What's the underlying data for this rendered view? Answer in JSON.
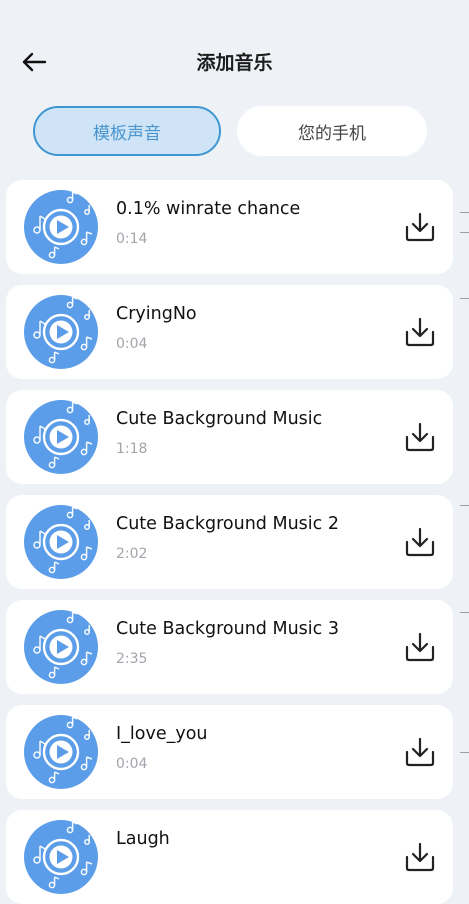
{
  "header": {
    "title": "添加音乐"
  },
  "tabs": [
    {
      "label": "模板声音",
      "active": true
    },
    {
      "label": "您的手机",
      "active": false
    }
  ],
  "songs": [
    {
      "title": "0.1% winrate chance",
      "duration": "0:14"
    },
    {
      "title": "CryingNo",
      "duration": "0:04"
    },
    {
      "title": "Cute Background Music",
      "duration": "1:18"
    },
    {
      "title": "Cute Background Music 2",
      "duration": "2:02"
    },
    {
      "title": "Cute Background Music 3",
      "duration": "2:35"
    },
    {
      "title": "I_love_you",
      "duration": "0:04"
    },
    {
      "title": "Laugh",
      "duration": ""
    }
  ],
  "colors": {
    "background": "#eef1f6",
    "disc": "#5b9de8",
    "tab_active_bg": "#cfe4f6",
    "tab_active_border": "#3f97d2",
    "tab_active_text": "#4a95cf"
  },
  "icons": {
    "back": "arrow-left-icon",
    "song_art": "music-disc-icon",
    "download": "download-icon"
  }
}
